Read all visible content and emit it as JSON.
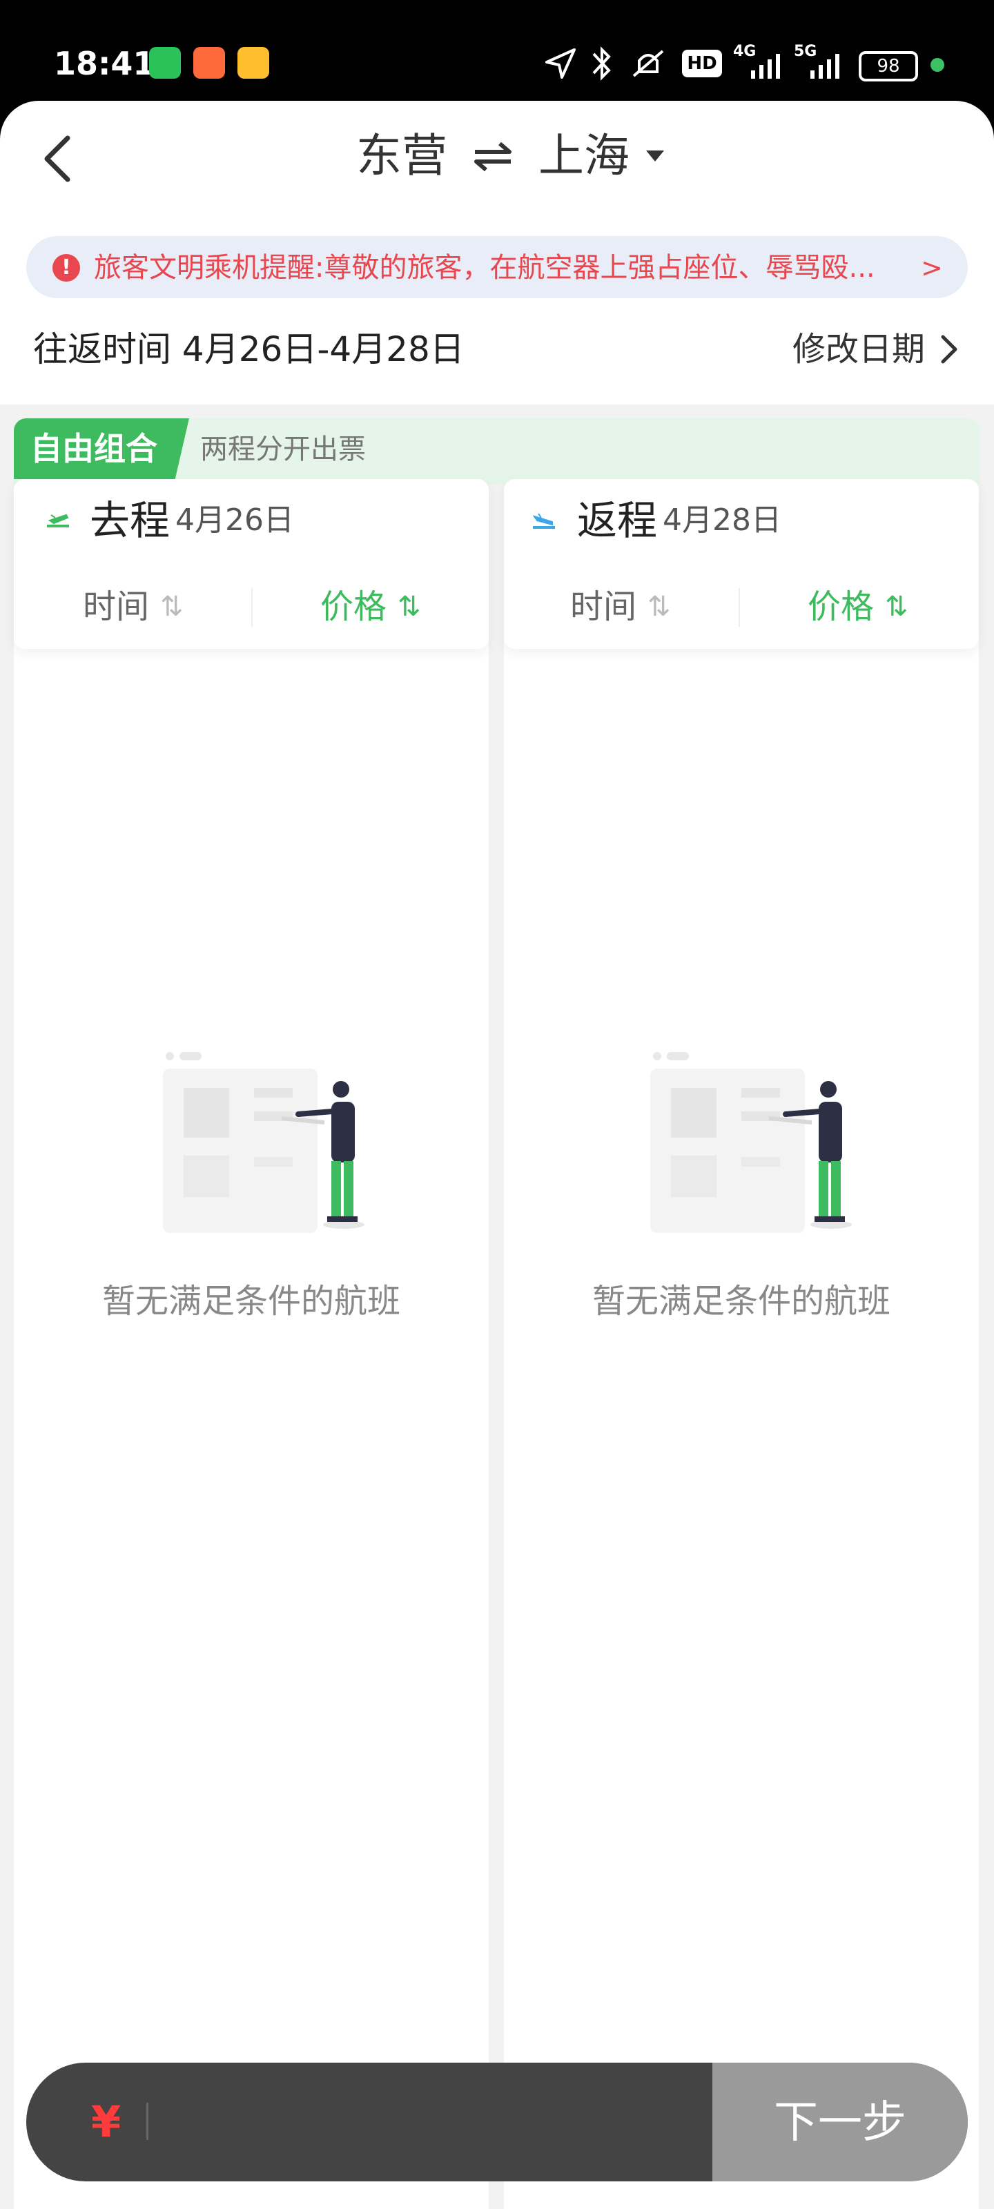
{
  "status_bar": {
    "time": "18:41",
    "battery": "98",
    "network_1": "4G",
    "network_2": "5G",
    "hd_badge": "HD"
  },
  "header": {
    "from": "东营",
    "to": "上海"
  },
  "notice": {
    "text": "旅客文明乘机提醒:尊敬的旅客，在航空器上强占座位、辱骂殴..."
  },
  "dates": {
    "label": "往返时间 4月26日-4月28日",
    "modify": "修改日期"
  },
  "combo": {
    "tag": "自由组合",
    "subtitle": "两程分开出票"
  },
  "outbound": {
    "title": "去程",
    "date": "4月26日",
    "sort_time": "时间",
    "sort_price": "价格",
    "empty": "暂无满足条件的航班"
  },
  "return": {
    "title": "返程",
    "date": "4月28日",
    "sort_time": "时间",
    "sort_price": "价格",
    "empty": "暂无满足条件的航班"
  },
  "bottom": {
    "currency": "¥",
    "next": "下一步"
  },
  "colors": {
    "accent_green": "#3dbb5e",
    "warning_red": "#e8474f",
    "plane_green": "#3dbb5e",
    "plane_blue": "#3aa6e8"
  }
}
